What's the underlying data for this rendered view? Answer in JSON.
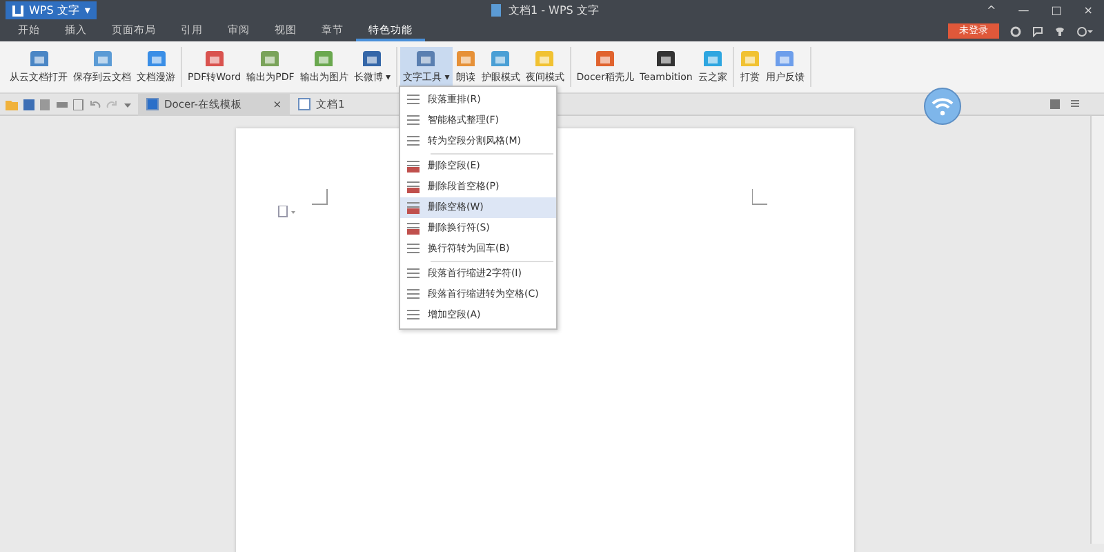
{
  "app_button": {
    "label": "WPS 文字",
    "caret": "▾"
  },
  "window": {
    "title": "文档1 - WPS 文字",
    "controls": [
      "^",
      "—",
      "□",
      "×"
    ]
  },
  "account": {
    "login": "未登录"
  },
  "menu_tabs": [
    {
      "label": "开始",
      "selected": false
    },
    {
      "label": "插入",
      "selected": false
    },
    {
      "label": "页面布局",
      "selected": false
    },
    {
      "label": "引用",
      "selected": false
    },
    {
      "label": "审阅",
      "selected": false
    },
    {
      "label": "视图",
      "selected": false
    },
    {
      "label": "章节",
      "selected": false
    },
    {
      "label": "特色功能",
      "selected": true
    }
  ],
  "ribbon_groups": [
    [
      {
        "label": "从云文档打开",
        "color": "#4a86c5",
        "selected": false
      },
      {
        "label": "保存到云文档",
        "color": "#5b9bd5",
        "selected": false
      },
      {
        "label": "文档漫游",
        "color": "#3a8ee6",
        "selected": false
      }
    ],
    [
      {
        "label": "PDF转Word",
        "color": "#d9534f",
        "selected": false
      },
      {
        "label": "输出为PDF",
        "color": "#7aa35a",
        "selected": false
      },
      {
        "label": "输出为图片",
        "color": "#6aa84f",
        "selected": false
      },
      {
        "label": "长微博 ▾",
        "color": "#3567a8",
        "selected": false
      }
    ],
    [
      {
        "label": "文字工具 ▾",
        "color": "#5a7fb0",
        "selected": true
      },
      {
        "label": "朗读",
        "color": "#e69138",
        "selected": false
      },
      {
        "label": "护眼模式",
        "color": "#4a9fd5",
        "selected": false
      },
      {
        "label": "夜间模式",
        "color": "#f1c232",
        "selected": false
      }
    ],
    [
      {
        "label": "Docer稻壳儿",
        "color": "#e0632e",
        "selected": false
      },
      {
        "label": "Teambition",
        "color": "#333333",
        "selected": false
      },
      {
        "label": "云之家",
        "color": "#2ea6e0",
        "selected": false
      }
    ],
    [
      {
        "label": "打赏",
        "color": "#f1c232",
        "selected": false
      },
      {
        "label": "用户反馈",
        "color": "#6d9eeb",
        "selected": false
      }
    ]
  ],
  "doc_tabs": [
    {
      "label": "Docer-在线模板",
      "close": "×",
      "selected": true
    },
    {
      "label": "文档1",
      "selected": false
    }
  ],
  "dropdown_groups": [
    [
      {
        "label": "段落重排(R)",
        "selected": false
      },
      {
        "label": "智能格式整理(F)",
        "selected": false
      },
      {
        "label": "转为空段分割风格(M)",
        "selected": false
      }
    ],
    [
      {
        "label": "删除空段(E)",
        "selected": false
      },
      {
        "label": "删除段首空格(P)",
        "selected": false
      },
      {
        "label": "删除空格(W)",
        "selected": true
      },
      {
        "label": "删除换行符(S)",
        "selected": false
      },
      {
        "label": "换行符转为回车(B)",
        "selected": false
      }
    ],
    [
      {
        "label": "段落首行缩进2字符(I)",
        "selected": false
      },
      {
        "label": "段落首行缩进转为空格(C)",
        "selected": false
      },
      {
        "label": "增加空段(A)",
        "selected": false
      }
    ]
  ]
}
